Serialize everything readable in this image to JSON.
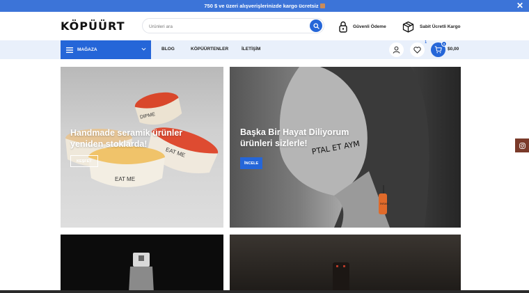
{
  "topbar": {
    "text": "750 $ ve üzeri alışverişlerinizde kargo ücretsiz"
  },
  "header": {
    "logo": "KÖPÜÜRT",
    "search_placeholder": "Ürünleri ara",
    "features": [
      {
        "icon": "lock-icon",
        "label": "Güvenli Ödeme"
      },
      {
        "icon": "box-icon",
        "label": "Sabit Ücretli Kargo"
      }
    ]
  },
  "nav": {
    "category_label": "MAĞAZA",
    "links": [
      "BLOG",
      "KÖPÜÜRTENLER",
      "İLETİŞİM"
    ],
    "wishlist_count": "1",
    "cart_count": "0",
    "cart_total": "$0,00"
  },
  "banners": [
    {
      "title": "Handmade seramik ürünler yeniden stoklarda!",
      "button": "KEŞFET",
      "bowl_text_1": "DIPME",
      "bowl_text_2": "EAT ME",
      "bowl_text_3": "EAT ME"
    },
    {
      "title": "Başka Bir Hayat Diliyorum ürünleri sizlerle!",
      "button": "İNCELE",
      "face_text": "PTAL ET AYM",
      "tag_text": "İNSAN"
    }
  ],
  "colors": {
    "accent": "#2566d8",
    "topbar": "#3c74d8",
    "nav_bg": "#e9f0fb",
    "instagram_tab": "#7a3a2a"
  }
}
